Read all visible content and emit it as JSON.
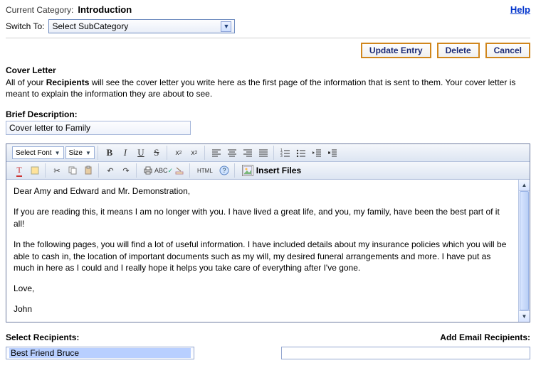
{
  "header": {
    "current_category_label": "Current Category:",
    "current_category_value": "Introduction",
    "help": "Help",
    "switch_label": "Switch To:",
    "switch_selected": "Select SubCategory"
  },
  "actions": {
    "update": "Update Entry",
    "delete": "Delete",
    "cancel": "Cancel"
  },
  "cover": {
    "title": "Cover Letter",
    "desc_prefix": "All of your ",
    "desc_bold": "Recipients",
    "desc_suffix": " will see the cover letter you write here as the first page of the information that is sent to them. Your cover letter is meant to explain the information they are about to see."
  },
  "brief": {
    "label": "Brief Description:",
    "value": "Cover letter to Family"
  },
  "toolbar": {
    "font_label": "Select Font",
    "size_label": "Size",
    "html_label": "HTML",
    "insert_files": "Insert Files"
  },
  "letter": {
    "p1": "Dear Amy and Edward and Mr. Demonstration,",
    "p2": "If you are reading this, it means I am no longer with you. I have lived a great life, and you, my family, have been the best part of it all!",
    "p3": "In the following pages, you will find a lot of useful information. I have included details about my insurance policies which you will be able to cash in, the location of important documents such as my will, my desired funeral arrangements and more. I have put as much in here as I could and I really hope it helps you take care of everything after I've gone.",
    "p4": "Love,",
    "p5": "John"
  },
  "bottom": {
    "select_recipients": "Select Recipients:",
    "add_email": "Add Email Recipients:",
    "recipient_option": "Best Friend Bruce"
  }
}
